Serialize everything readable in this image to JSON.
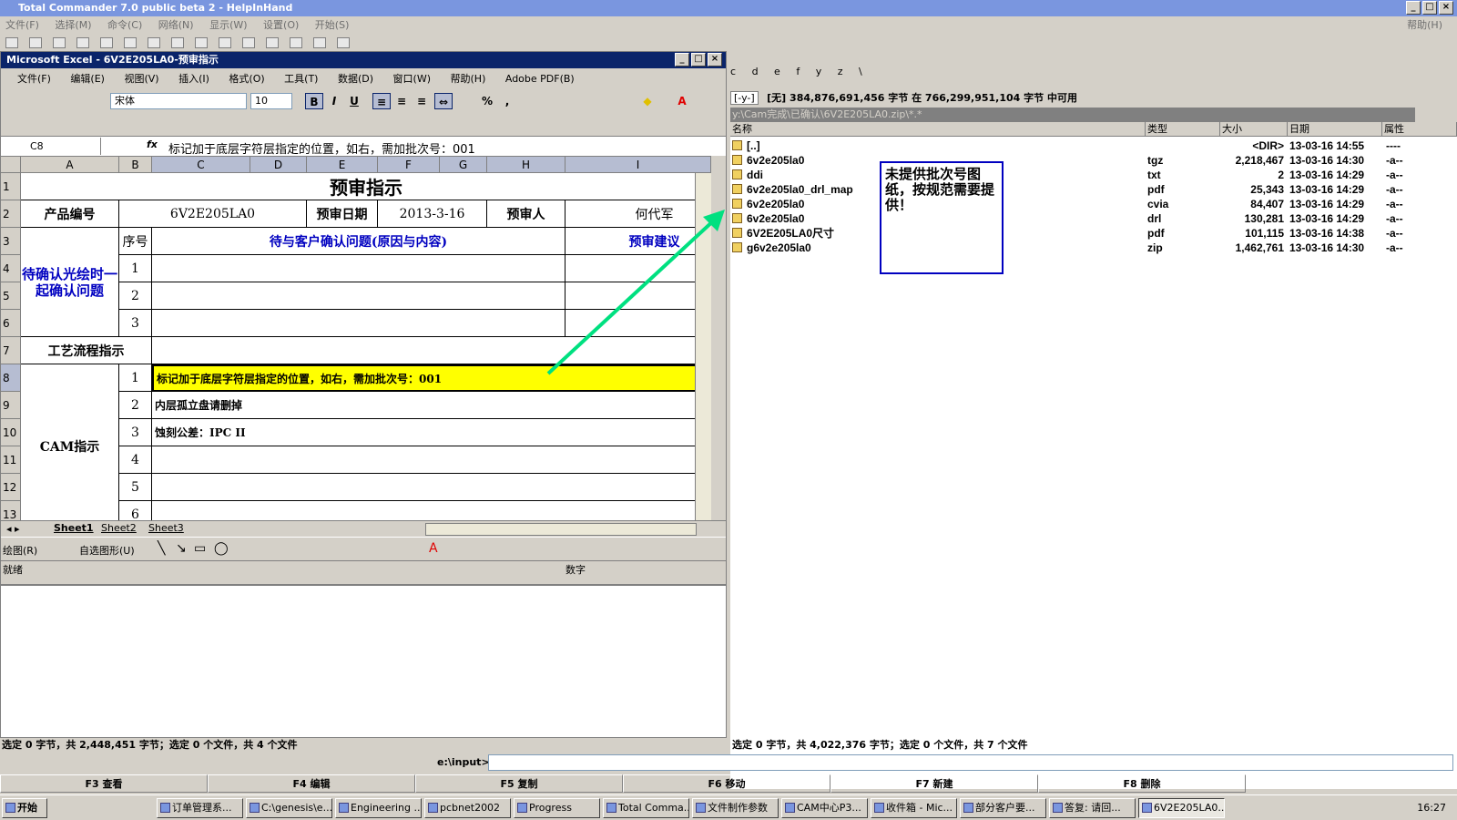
{
  "tc": {
    "title": "Total Commander 7.0 public beta 2 - HelpInHand",
    "menu": [
      "文件(F)",
      "选择(M)",
      "命令(C)",
      "网络(N)",
      "显示(W)",
      "设置(O)",
      "开始(S)"
    ],
    "help": "帮助(H)"
  },
  "excel": {
    "title": "Microsoft Excel - 6V2E205LA0-预审指示",
    "menu": [
      "文件(F)",
      "编辑(E)",
      "视图(V)",
      "插入(I)",
      "格式(O)",
      "工具(T)",
      "数据(D)",
      "窗口(W)",
      "帮助(H)",
      "Adobe PDF(B)"
    ],
    "font": "宋体",
    "size": "10",
    "namebox": "C8",
    "fx": "fx",
    "formula": "标记加于底层字符层指定的位置，如右，需加批次号：001",
    "columns": [
      "A",
      "B",
      "C",
      "D",
      "E",
      "F",
      "G",
      "H",
      "I"
    ],
    "rows": [
      "1",
      "2",
      "3",
      "4",
      "5",
      "6",
      "7",
      "8",
      "9",
      "10",
      "11",
      "12",
      "13"
    ],
    "cells": {
      "title": "预审指示",
      "product_label": "产品编号",
      "product_value": "6V2E205LA0",
      "date_label": "预审日期",
      "date_value": "2013-3-16",
      "reviewer_label": "预审人",
      "reviewer_value": "何代军",
      "seq_label": "序号",
      "issue_header": "待与客户确认问题(原因与内容)",
      "suggest_header": "预审建议",
      "confirm_group": "待确认光绘时一起确认问题",
      "process_label": "工艺流程指示",
      "cam_label": "CAM指示",
      "seq": [
        "1",
        "2",
        "3"
      ],
      "cam_seq": [
        "1",
        "2",
        "3",
        "4",
        "5",
        "6"
      ],
      "cam_items": [
        "标记加于底层字符层指定的位置，如右，需加批次号：001",
        "内层孤立盘请删掉",
        "蚀刻公差：IPC II",
        "",
        "",
        ""
      ]
    },
    "sheets": [
      "Sheet1",
      "Sheet2",
      "Sheet3"
    ],
    "draw": "绘图(R)",
    "autoshape": "自选图形(U)",
    "status_ready": "就绪",
    "status_num": "数字"
  },
  "panel": {
    "drives": [
      "c",
      "d",
      "e",
      "f",
      "y",
      "z",
      "\\"
    ],
    "drive_combo": "[-y-]",
    "space": "[无]  384,876,691,456 字节 在 766,299,951,104 字节 中可用",
    "path": "y:\\Cam完成\\已确认\\6V2E205LA0.zip\\*.*",
    "headers": [
      "名称",
      "类型",
      "大小",
      "日期",
      "属性"
    ],
    "files": [
      {
        "name": "[..]",
        "type": "",
        "size": "<DIR>",
        "date": "13-03-16 14:55",
        "attr": "----"
      },
      {
        "name": "6v2e205la0",
        "type": "tgz",
        "size": "2,218,467",
        "date": "13-03-16 14:30",
        "attr": "-a--"
      },
      {
        "name": "ddi",
        "type": "txt",
        "size": "2",
        "date": "13-03-16 14:29",
        "attr": "-a--"
      },
      {
        "name": "6v2e205la0_drl_map",
        "type": "pdf",
        "size": "25,343",
        "date": "13-03-16 14:29",
        "attr": "-a--"
      },
      {
        "name": "6v2e205la0",
        "type": "cvia",
        "size": "84,407",
        "date": "13-03-16 14:29",
        "attr": "-a--"
      },
      {
        "name": "6v2e205la0",
        "type": "drl",
        "size": "130,281",
        "date": "13-03-16 14:29",
        "attr": "-a--"
      },
      {
        "name": "6V2E205LA0尺寸",
        "type": "pdf",
        "size": "101,115",
        "date": "13-03-16 14:38",
        "attr": "-a--"
      },
      {
        "name": "g6v2e205la0",
        "type": "zip",
        "size": "1,462,761",
        "date": "13-03-16 14:30",
        "attr": "-a--"
      }
    ],
    "note": "未提供批次号图纸，按规范需要提供！"
  },
  "status": {
    "left": "选定 0 字节，共 2,448,451 字节；选定 0 个文件，共 4 个文件",
    "right": "选定 0 字节，共 4,022,376 字节；选定 0 个文件，共 7 个文件"
  },
  "cmd": {
    "prompt": "e:\\input>"
  },
  "fkeys": [
    "F3 查看",
    "F4 编辑",
    "F5 复制",
    "F6 移动",
    "F7 新建",
    "F8 删除"
  ],
  "taskbar": {
    "start": "开始",
    "tasks": [
      "订单管理系...",
      "C:\\genesis\\e...",
      "Engineering ...",
      "pcbnet2002",
      "Progress",
      "Total Comma...",
      "文件制作参数",
      "CAM中心P3...",
      "收件箱 - Mic...",
      "部分客户要...",
      "答复: 请回...",
      "6V2E205LA0..."
    ],
    "clock": "16:27"
  },
  "colors": {
    "highlight": "#ffff00",
    "arrow": "#00e080",
    "blue_text": "#0000c0",
    "title_active": "#0a246a"
  }
}
